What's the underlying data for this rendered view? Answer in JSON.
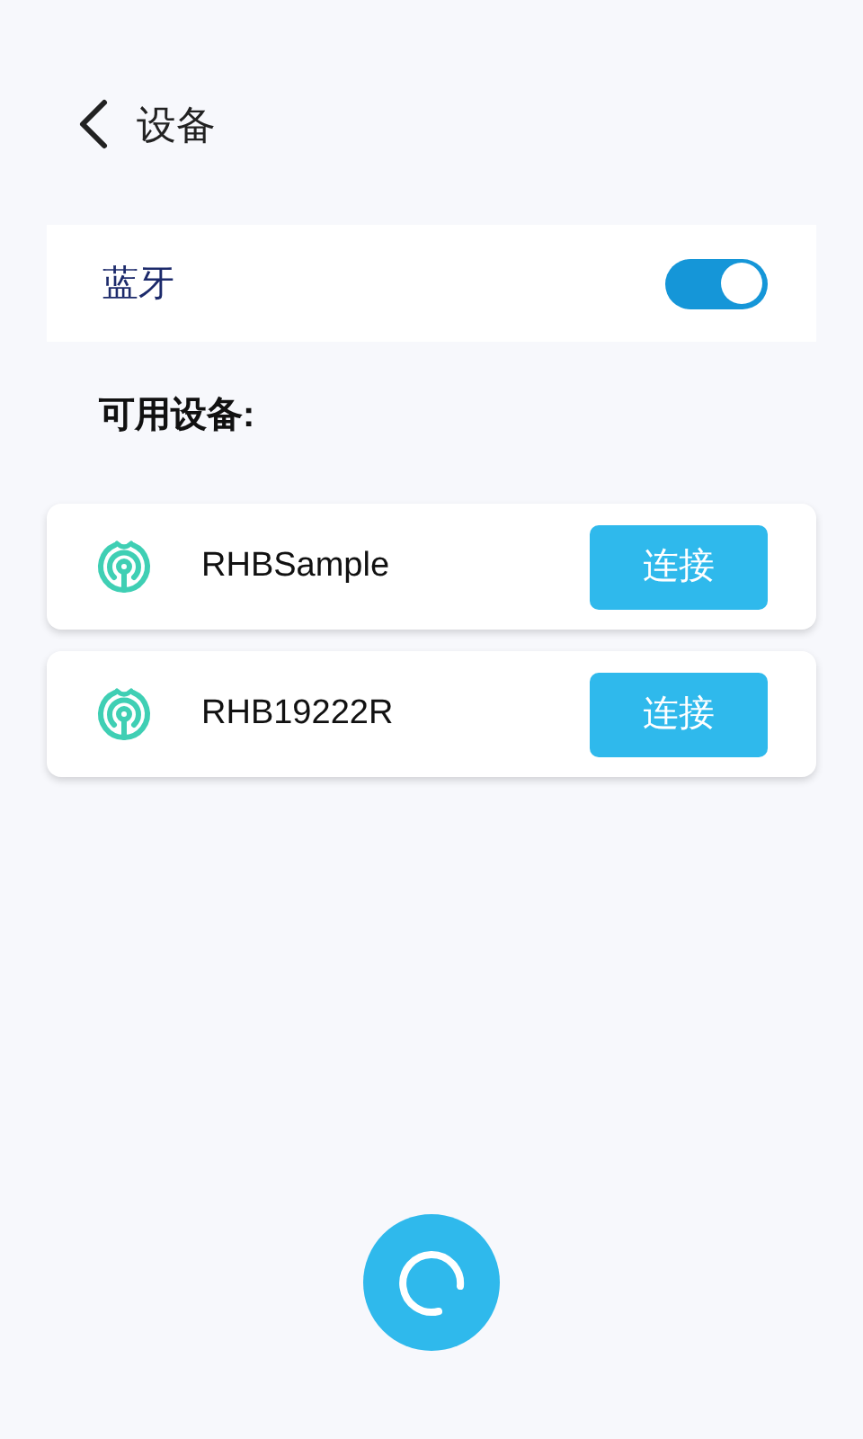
{
  "header": {
    "title": "设备"
  },
  "bluetooth": {
    "label": "蓝牙",
    "on": true
  },
  "section_title": "可用设备:",
  "devices": [
    {
      "name": "RHBSample",
      "action": "连接"
    },
    {
      "name": "RHB19222R",
      "action": "连接"
    }
  ]
}
